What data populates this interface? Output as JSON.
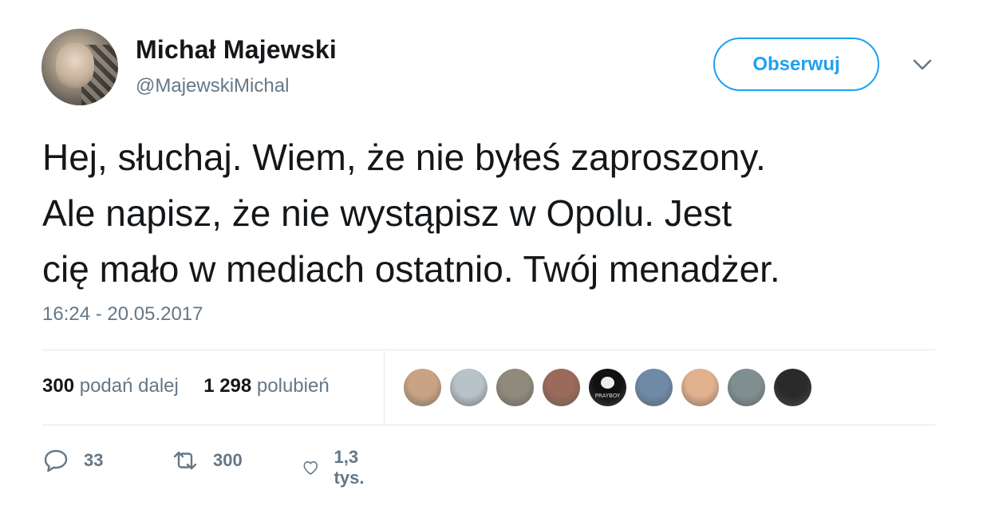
{
  "author": {
    "name": "Michał Majewski",
    "handle": "@MajewskiMichal"
  },
  "follow_button": {
    "label": "Obserwuj"
  },
  "tweet": {
    "lines": [
      "Hej, słuchaj. Wiem, że nie byłeś zaproszony.",
      "Ale napisz, że nie wystąpisz w Opolu. Jest",
      "cię mało w mediach ostatnio. Twój menadżer."
    ],
    "timestamp": "16:24 - 20.05.2017"
  },
  "stats": {
    "retweets_count": "300",
    "retweets_label": "podań dalej",
    "likes_count": "1 298",
    "likes_label": "polubień"
  },
  "likers": [
    {
      "name": "liker-1",
      "color": "#c9a383"
    },
    {
      "name": "liker-2",
      "color": "#b8c2c9"
    },
    {
      "name": "liker-3",
      "color": "#8f8a7c"
    },
    {
      "name": "liker-4",
      "color": "#9a6a5a"
    },
    {
      "name": "liker-5",
      "color": "#111111",
      "text": "PRAYBOY"
    },
    {
      "name": "liker-6",
      "color": "#6e8aa6"
    },
    {
      "name": "liker-7",
      "color": "#e2b18e"
    },
    {
      "name": "liker-8",
      "color": "#7f8f90"
    },
    {
      "name": "liker-9",
      "color": "#2a2a2a"
    }
  ],
  "actions": {
    "reply_count": "33",
    "retweet_count": "300",
    "like_count": "1,3 tys."
  },
  "colors": {
    "accent": "#1da1f2",
    "secondary_text": "#657786",
    "primary_text": "#14171a",
    "divider": "#e1e8ed"
  },
  "icons": [
    "chevron-down-icon",
    "reply-icon",
    "retweet-icon",
    "heart-icon"
  ]
}
